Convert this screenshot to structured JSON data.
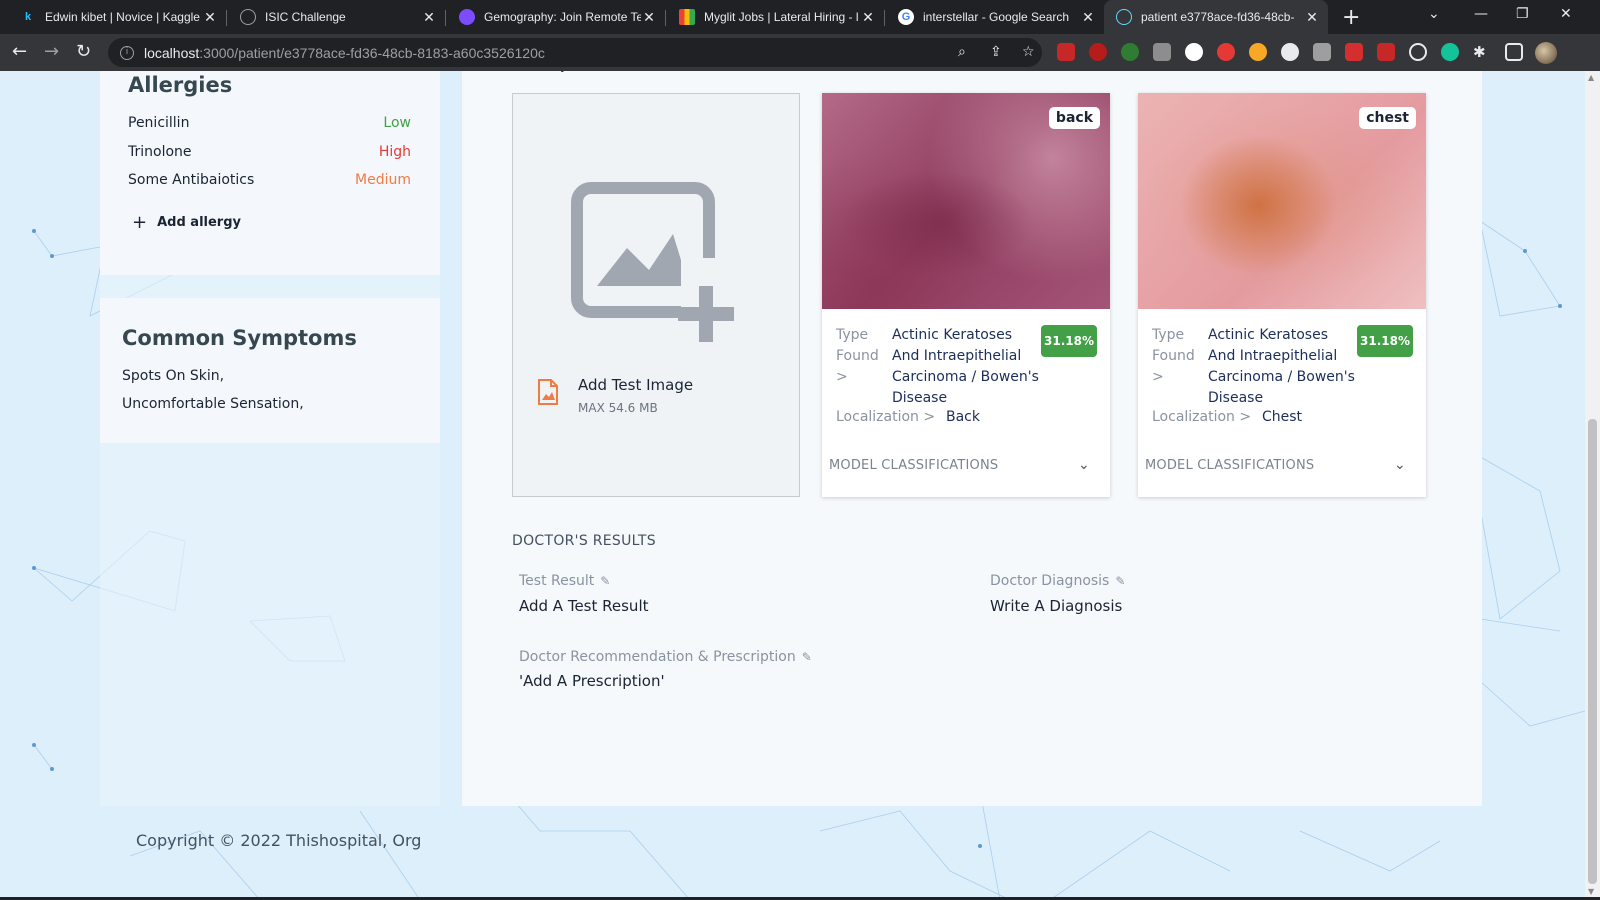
{
  "browser": {
    "tabs": [
      {
        "title": "Edwin kibet | Novice | Kaggle",
        "favicon": "kaggle-icon",
        "color": "#20beff"
      },
      {
        "title": "ISIC Challenge",
        "favicon": "globe-icon",
        "color": "#9aa0a6"
      },
      {
        "title": "Gemography: Join Remote Te",
        "favicon": "gemography-icon",
        "color": "#7c4dff"
      },
      {
        "title": "Myglit Jobs | Lateral Hiring - l",
        "favicon": "myglit-icon",
        "color": "#f4b400"
      },
      {
        "title": "interstellar - Google Search",
        "favicon": "google-icon",
        "color": "#ffffff"
      },
      {
        "title": "patient e3778ace-fd36-48cb-",
        "favicon": "react-icon",
        "color": "#61dafb"
      }
    ],
    "url_host": "localhost",
    "url_path": ":3000/patient/e3778ace-fd36-48cb-8183-a60c3526120c"
  },
  "allergies": {
    "title": "Allergies",
    "items": [
      {
        "name": "Penicillin",
        "level": "Low"
      },
      {
        "name": "Trinolone",
        "level": "High"
      },
      {
        "name": "Some Antibaiotics",
        "level": "Medium"
      }
    ],
    "add_label": "Add allergy"
  },
  "symptoms": {
    "title": "Common Symptoms",
    "items": [
      "Spots On Skin,",
      "Uncomfortable Sensation,"
    ]
  },
  "main": {
    "description_label": "description",
    "upload": {
      "title": "Add Test Image",
      "max": "MAX 54.6 MB"
    },
    "cards": [
      {
        "location_badge": "back",
        "type_label": "Type Found >",
        "type_value": "Actinic Keratoses And Intraepithelial Carcinoma / Bowen's Disease",
        "confidence": "31.18%",
        "localization_label": "Localization >",
        "localization_value": "Back",
        "classifications_label": "MODEL CLASSIFICATIONS"
      },
      {
        "location_badge": "chest",
        "type_label": "Type Found >",
        "type_value": "Actinic Keratoses And Intraepithelial Carcinoma / Bowen's Disease",
        "confidence": "31.18%",
        "localization_label": "Localization >",
        "localization_value": "Chest",
        "classifications_label": "MODEL CLASSIFICATIONS"
      }
    ],
    "doctor_results": {
      "heading": "DOCTOR'S RESULTS",
      "test_result_label": "Test Result",
      "test_result_value": "Add A Test Result",
      "diagnosis_label": "Doctor Diagnosis",
      "diagnosis_value": "Write A Diagnosis",
      "prescription_label": "Doctor Recommendation & Prescription",
      "prescription_value": "'Add A Prescription'"
    }
  },
  "footer": {
    "copyright": "Copyright © 2022 Thishospital, Org"
  },
  "colors": {
    "low": "#43a047",
    "high": "#e53935",
    "medium": "#ef7b45",
    "badge": "#43a047",
    "navy": "#1c2e5a"
  }
}
